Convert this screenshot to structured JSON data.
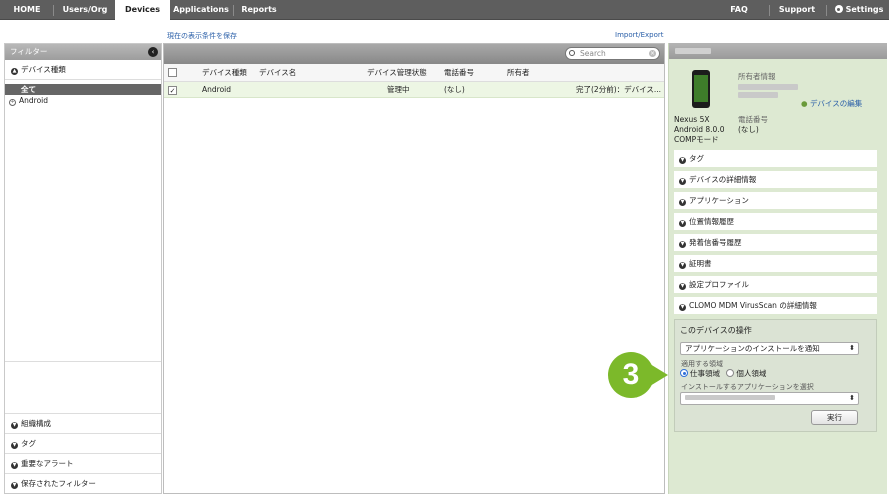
{
  "topnav": {
    "home": "HOME",
    "users": "Users/Org",
    "devices": "Devices",
    "applications": "Applications",
    "reports": "Reports",
    "faq": "FAQ",
    "support": "Support",
    "settings": "Settings"
  },
  "toolbar": {
    "save_view": "現在の表示条件を保存",
    "import_export": "Import/Export"
  },
  "filter": {
    "header": "フィルター",
    "device_type": "デバイス種類",
    "all": "全て",
    "android": "Android",
    "bottom": [
      "組織構成",
      "タグ",
      "重要なアラート",
      "保存されたフィルター"
    ]
  },
  "table": {
    "search_placeholder": "Search",
    "headers": [
      "デバイス種類",
      "デバイス名",
      "デバイス管理状態",
      "電話番号",
      "所有者"
    ],
    "rows": [
      {
        "type": "Android",
        "name": "",
        "status": "管理中",
        "phone": "(なし)",
        "owner": "",
        "note": "完了(2分前)：デバイス..."
      }
    ]
  },
  "detail": {
    "owner_label": "所有者情報",
    "edit_device": "デバイスの編集",
    "phone_label": "電話番号",
    "phone_value": "(なし)",
    "model": "Nexus 5X",
    "os": "Android 8.0.0",
    "mode": "COMPモード",
    "sections": [
      "タグ",
      "デバイスの詳細情報",
      "アプリケーション",
      "位置情報履歴",
      "発着信番号履歴",
      "証明書",
      "設定プロファイル",
      "CLOMO MDM VirusScan の詳細情報"
    ]
  },
  "ops": {
    "title": "このデバイスの操作",
    "action": "アプリケーションのインストールを通知",
    "scope_label": "適用する領域",
    "scope_work": "仕事領域",
    "scope_personal": "個人領域",
    "app_label": "インストールするアプリケーションを選択",
    "run": "実行"
  },
  "callout": "3",
  "colors": {
    "accent_green": "#7cb92a",
    "nav_bg": "#5e5e5e",
    "link": "#2a5fa8"
  }
}
